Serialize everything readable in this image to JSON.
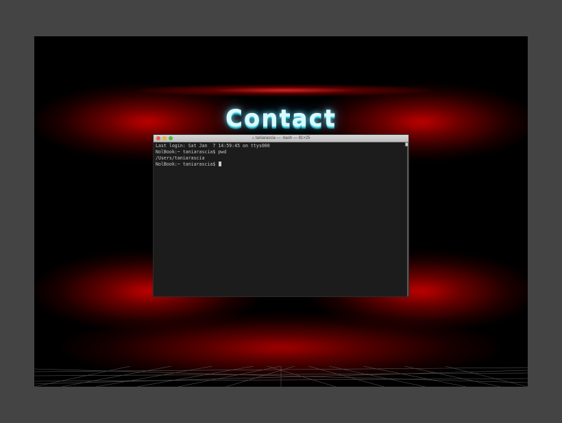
{
  "page": {
    "heading": "Contact"
  },
  "terminal": {
    "window_title": "taniarascia — -bash — 81×25",
    "title_icon": "home-folder-icon",
    "lines": [
      "Last login: Sat Jan  7 14:59:45 on ttys000",
      "NolBook:~ taniarascia$ pwd",
      "/Users/taniarascia",
      "NolBook:~ taniarascia$ "
    ]
  },
  "colors": {
    "frame": "#444444",
    "background": "#000000",
    "glow": "#cc0000",
    "heading": "#d9fbff",
    "terminal_bg": "#1c1c1c",
    "terminal_text": "#c9c9c9"
  }
}
